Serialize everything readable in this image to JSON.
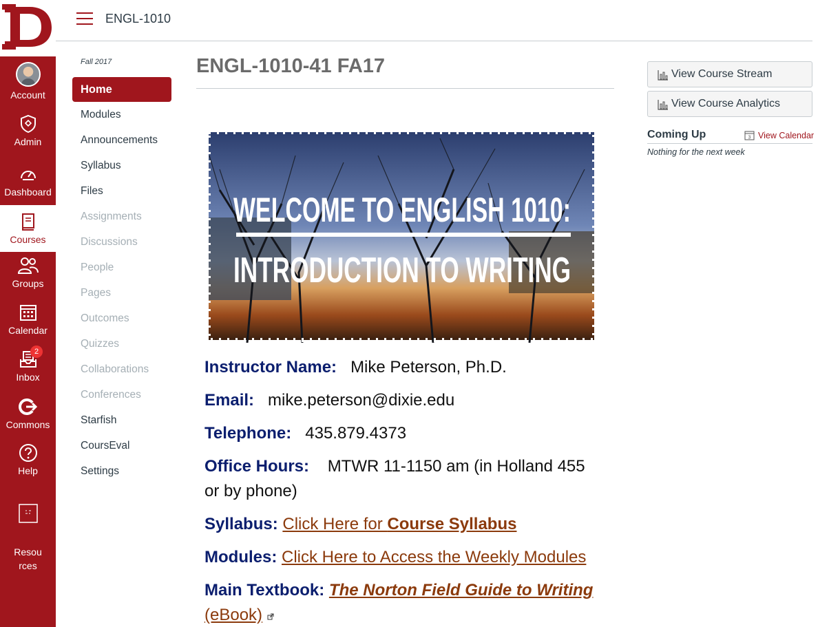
{
  "global_nav": {
    "account": "Account",
    "admin": "Admin",
    "dashboard": "Dashboard",
    "courses": "Courses",
    "groups": "Groups",
    "calendar": "Calendar",
    "inbox": "Inbox",
    "inbox_badge": "2",
    "commons": "Commons",
    "help": "Help",
    "resources": "Resou\nrces",
    "accent_color": "#a0161d"
  },
  "header": {
    "breadcrumb": "ENGL-1010"
  },
  "course_nav": {
    "term": "Fall 2017",
    "items": [
      {
        "label": "Home"
      },
      {
        "label": "Modules"
      },
      {
        "label": "Announcements"
      },
      {
        "label": "Syllabus"
      },
      {
        "label": "Files"
      },
      {
        "label": "Assignments"
      },
      {
        "label": "Discussions"
      },
      {
        "label": "People"
      },
      {
        "label": "Pages"
      },
      {
        "label": "Outcomes"
      },
      {
        "label": "Quizzes"
      },
      {
        "label": "Collaborations"
      },
      {
        "label": "Conferences"
      },
      {
        "label": "Starfish"
      },
      {
        "label": "CoursEval"
      },
      {
        "label": "Settings"
      }
    ]
  },
  "main": {
    "title": "ENGL-1010-41 FA17",
    "banner": {
      "line1": "WELCOME TO ENGLISH 1010:",
      "line2": "INTRODUCTION TO WRITING"
    },
    "instructor_label": "Instructor Name:",
    "instructor_value": "Mike Peterson, Ph.D.",
    "email_label": "Email:",
    "email_value": "mike.peterson@dixie.edu",
    "phone_label": "Telephone:",
    "phone_value": "435.879.4373",
    "office_label": "Office Hours:",
    "office_value_1": "MTWR 11-1150 am (in Holland 455",
    "office_value_2": "or by phone)",
    "syllabus_label": "Syllabus:",
    "syllabus_link_a": "Click Here for ",
    "syllabus_link_b": "Course Syllabus",
    "modules_label": "Modules:",
    "modules_link": "Click Here to Access the Weekly Modules",
    "textbook_label": "Main Textbook:",
    "textbook_link": "The Norton Field Guide to Writing",
    "textbook_link_2": "(eBook)"
  },
  "sidebar": {
    "stream_button": "View Course Stream",
    "analytics_button": "View Course Analytics",
    "coming_up": "Coming Up",
    "view_calendar": "View Calendar",
    "calendar_icon_day": "3",
    "nothing": "Nothing for the next week"
  }
}
